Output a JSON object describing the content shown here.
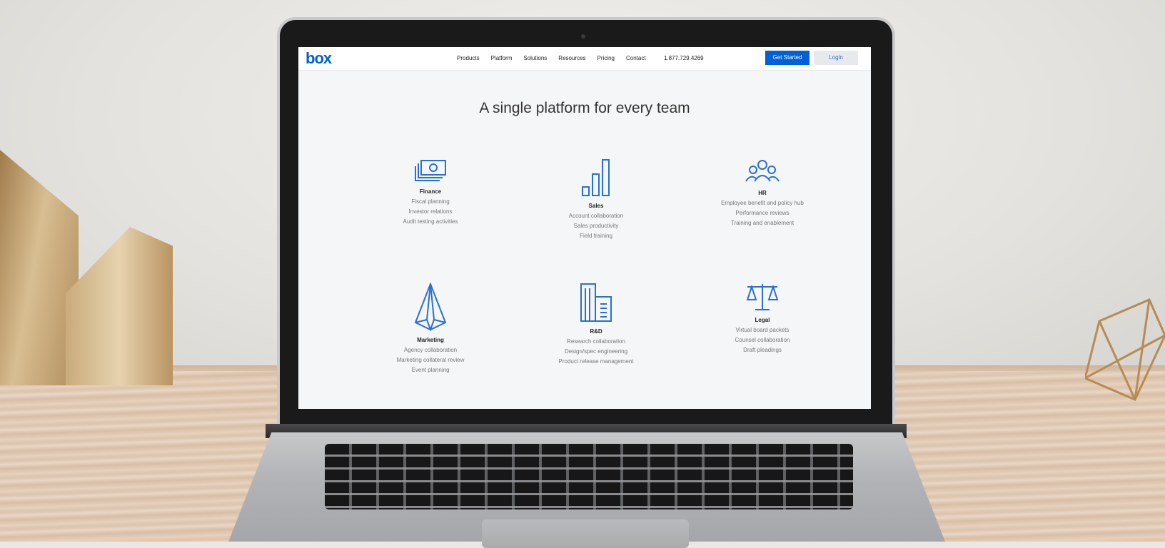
{
  "nav": {
    "logo": "box",
    "links": [
      "Products",
      "Platform",
      "Solutions",
      "Resources",
      "Pricing",
      "Contact"
    ],
    "phone": "1.877.729.4269",
    "get_started": "Get Started",
    "login": "Login"
  },
  "hero": {
    "title": "A single platform for every team"
  },
  "teams": [
    {
      "icon": "money-icon",
      "title": "Finance",
      "items": [
        "Fiscal planning",
        "Investor relations",
        "Audit testing activities"
      ]
    },
    {
      "icon": "bar-chart-icon",
      "title": "Sales",
      "items": [
        "Account collaboration",
        "Sales productivity",
        "Field training"
      ]
    },
    {
      "icon": "people-icon",
      "title": "HR",
      "items": [
        "Employee benefit and policy hub",
        "Performance reviews",
        "Training and enablement"
      ]
    },
    {
      "icon": "paper-plane-icon",
      "title": "Marketing",
      "items": [
        "Agency collaboration",
        "Marketing collateral review",
        "Event planning"
      ]
    },
    {
      "icon": "building-icon",
      "title": "R&D",
      "items": [
        "Research collaboration",
        "Design/spec engineering",
        "Product release management"
      ]
    },
    {
      "icon": "scales-icon",
      "title": "Legal",
      "items": [
        "Virtual board packets",
        "Counsel collaboration",
        "Draft pleadings"
      ]
    }
  ],
  "colors": {
    "brand": "#0061d5",
    "icon": "#2b6fd6"
  }
}
